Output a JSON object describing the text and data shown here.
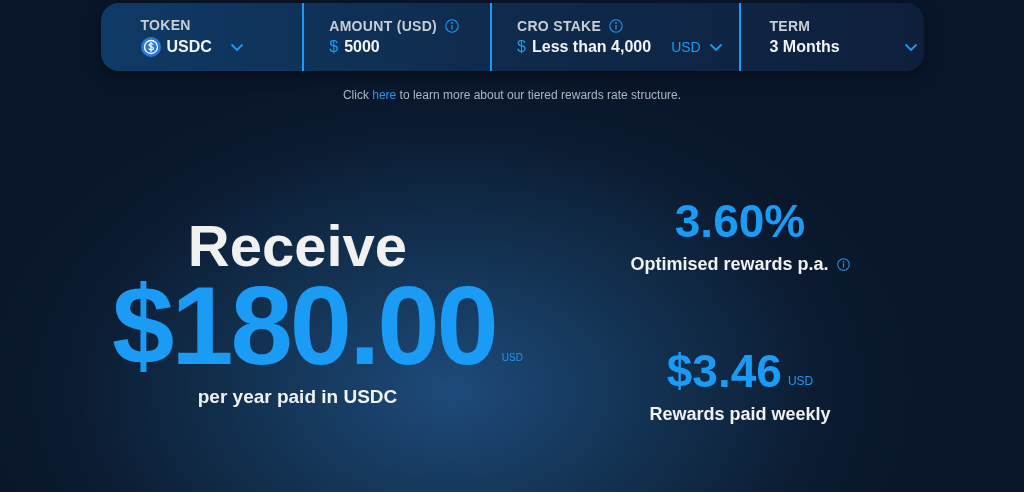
{
  "fields": [
    {
      "kind": "token",
      "label": "TOKEN",
      "value": "USDC",
      "info": false,
      "dropdown": true
    },
    {
      "kind": "input",
      "label": "AMOUNT (USD)",
      "value": "5000",
      "info": true,
      "prefix": "$",
      "dropdown": false
    },
    {
      "kind": "input",
      "label": "CRO STAKE",
      "value": "Less than 4,000",
      "info": true,
      "prefix": "$",
      "unit": "USD",
      "dropdown": true
    },
    {
      "kind": "select",
      "label": "TERM",
      "value": "3 Months",
      "info": false,
      "dropdown": true
    }
  ],
  "note": {
    "before": "Click ",
    "link": "here",
    "after": " to learn more about our tiered rewards rate structure."
  },
  "main": {
    "heading": "Receive",
    "amount": "$180.00",
    "currency": "USD",
    "caption": "per year paid in USDC"
  },
  "stats": [
    {
      "value": "3.60%",
      "label": "Optimised rewards p.a.",
      "info": true
    },
    {
      "value": "$3.46",
      "currency": "USD",
      "label": "Rewards paid weekly",
      "info": false
    }
  ]
}
